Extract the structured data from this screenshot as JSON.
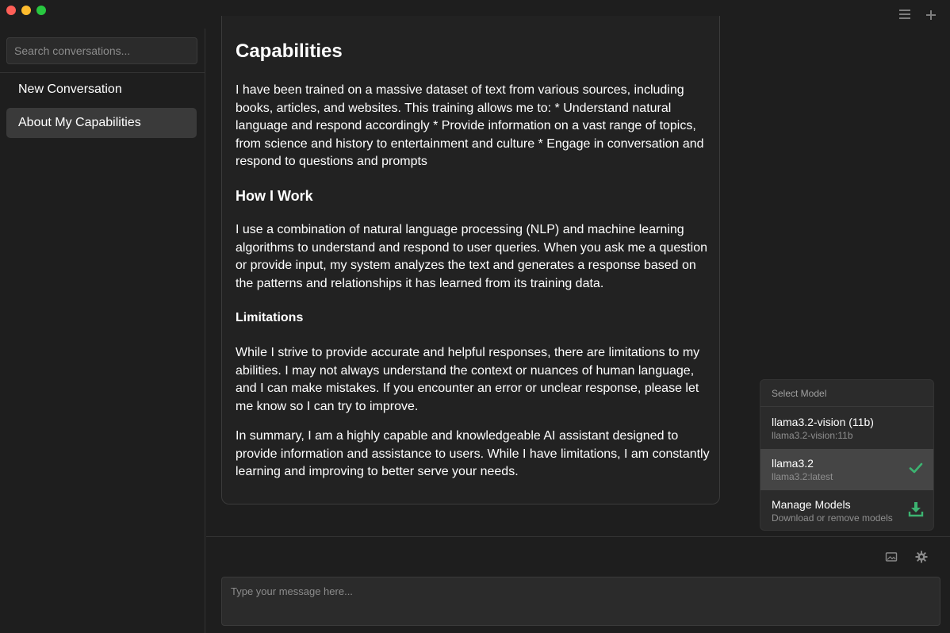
{
  "window": {
    "menu_icon": "hamburger-menu-icon",
    "new_icon": "plus-icon"
  },
  "sidebar": {
    "search_placeholder": "Search conversations...",
    "conversations": [
      {
        "label": "New Conversation",
        "active": false
      },
      {
        "label": "About My Capabilities",
        "active": true
      }
    ]
  },
  "message": {
    "heading": "Capabilities",
    "para1": "I have been trained on a massive dataset of text from various sources, including books, articles, and websites. This training allows me to: * Understand natural language and respond accordingly * Provide information on a vast range of topics, from science and history to entertainment and culture * Engage in conversation and respond to questions and prompts",
    "subheading1": "How I Work",
    "para2": "I use a combination of natural language processing (NLP) and machine learning algorithms to understand and respond to user queries. When you ask me a question or provide input, my system analyzes the text and generates a response based on the patterns and relationships it has learned from its training data.",
    "subheading2": "Limitations",
    "para3": "While I strive to provide accurate and helpful responses, there are limitations to my abilities. I may not always understand the context or nuances of human language, and I can make mistakes. If you encounter an error or unclear response, please let me know so I can try to improve.",
    "para4": "In summary, I am a highly capable and knowledgeable AI assistant designed to provide information and assistance to users. While I have limitations, I am constantly learning and improving to better serve your needs."
  },
  "model_menu": {
    "header": "Select Model",
    "items": [
      {
        "name": "llama3.2-vision (11b)",
        "id": "llama3.2-vision:11b",
        "selected": false
      },
      {
        "name": "llama3.2",
        "id": "llama3.2:latest",
        "selected": true,
        "icon": "checkmark-icon"
      },
      {
        "name": "Manage Models",
        "id": "Download or remove models",
        "icon": "download-icon"
      }
    ],
    "accent_color": "#3cb371"
  },
  "composer": {
    "placeholder": "Type your message here...",
    "image_icon": "image-icon",
    "settings_icon": "gear-icon"
  }
}
